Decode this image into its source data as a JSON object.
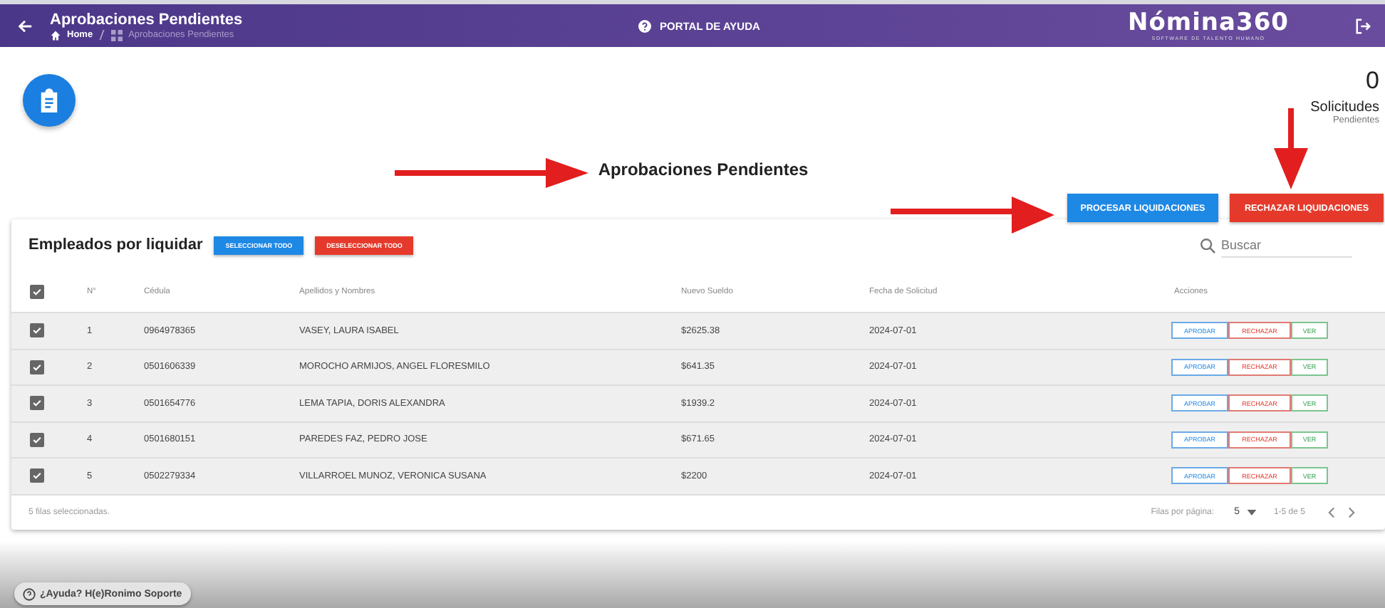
{
  "header": {
    "title": "Aprobaciones Pendientes",
    "breadcrumb": [
      "Home",
      "Aprobaciones Pendientes"
    ],
    "help_link": "PORTAL DE AYUDA",
    "logo": "Nómina360",
    "logo_tagline": "SOFTWARE DE TALENTO HUMANO"
  },
  "counter": {
    "value": "0",
    "label": "Solicitudes",
    "sublabel": "Pendientes"
  },
  "page_title": "Aprobaciones Pendientes",
  "action_buttons": [
    {
      "label": "PROCESAR LIQUIDACIONES",
      "kind": "primary"
    },
    {
      "label": "RECHAZAR LIQUIDACIONES",
      "kind": "danger"
    }
  ],
  "table": {
    "title": "Empleados por liquidar",
    "select_all": "SELECCIONAR TODO",
    "deselect_all": "DESELECCIONAR TODO",
    "search": {
      "placeholder": "Buscar"
    },
    "header_checked": true,
    "columns": [
      "N°",
      "Cédula",
      "Apellidos y Nombres",
      "Nuevo Sueldo",
      "Fecha de Solicitud",
      "Acciones"
    ],
    "rows": [
      {
        "checked": true,
        "cells": [
          "1",
          "0964978365",
          "VASEY, LAURA ISABEL",
          "$2625.38",
          "2024-07-01"
        ],
        "actions": [
          {
            "label": "APROBAR",
            "kind": "approve"
          },
          {
            "label": "RECHAZAR",
            "kind": "reject"
          },
          {
            "label": "VER",
            "kind": "view"
          }
        ]
      },
      {
        "checked": true,
        "cells": [
          "2",
          "0501606339",
          "MOROCHO ARMIJOS, ANGEL FLORESMILO",
          "$641.35",
          "2024-07-01"
        ],
        "actions": [
          {
            "label": "APROBAR",
            "kind": "approve"
          },
          {
            "label": "RECHAZAR",
            "kind": "reject"
          },
          {
            "label": "VER",
            "kind": "view"
          }
        ]
      },
      {
        "checked": true,
        "cells": [
          "3",
          "0501654776",
          "LEMA TAPIA, DORIS ALEXANDRA",
          "$1939.2",
          "2024-07-01"
        ],
        "actions": [
          {
            "label": "APROBAR",
            "kind": "approve"
          },
          {
            "label": "RECHAZAR",
            "kind": "reject"
          },
          {
            "label": "VER",
            "kind": "view"
          }
        ]
      },
      {
        "checked": true,
        "cells": [
          "4",
          "0501680151",
          "PAREDES FAZ, PEDRO JOSE",
          "$671.65",
          "2024-07-01"
        ],
        "actions": [
          {
            "label": "APROBAR",
            "kind": "approve"
          },
          {
            "label": "RECHAZAR",
            "kind": "reject"
          },
          {
            "label": "VER",
            "kind": "view"
          }
        ]
      },
      {
        "checked": true,
        "cells": [
          "5",
          "0502279334",
          "VILLARROEL MUNOZ, VERONICA SUSANA",
          "$2200",
          "2024-07-01"
        ],
        "actions": [
          {
            "label": "APROBAR",
            "kind": "approve"
          },
          {
            "label": "RECHAZAR",
            "kind": "reject"
          },
          {
            "label": "VER",
            "kind": "view"
          }
        ]
      }
    ],
    "footer": {
      "selected_count": "5 filas seleccionadas.",
      "rows_per_page_label": "Filas por página:",
      "rows_per_page": "5",
      "range": "1-5 de 5"
    }
  },
  "help_chip": "¿Ayuda? H(e)Ronimo Soporte"
}
